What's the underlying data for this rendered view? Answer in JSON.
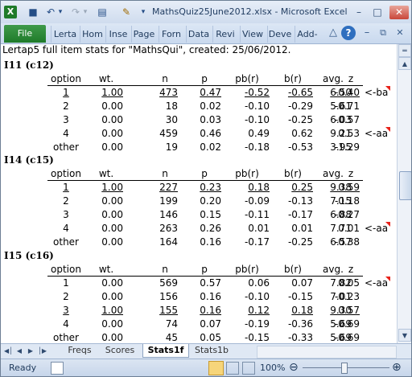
{
  "window": {
    "title": "MathsQuiz25June2012.xlsx - Microsoft Excel",
    "controls": {
      "minimize": "–",
      "maximize": "□",
      "close": "✕"
    }
  },
  "quick_access": {
    "app_icon": "X",
    "save": "■",
    "undo": "↶",
    "undo_drop": "▾",
    "redo": "↷",
    "redo_drop": "▾",
    "form": "▤",
    "brush": "✎",
    "customize": "▾"
  },
  "ribbon": {
    "file_label": "File",
    "tabs": [
      "Lerta",
      "Hom",
      "Inse",
      "Page",
      "Forn",
      "Data",
      "Revi",
      "View",
      "Deve",
      "Add-"
    ],
    "icons": {
      "minimize_ribbon": "△",
      "help": "?",
      "min": "–",
      "restore": "⧉",
      "close": "✕"
    }
  },
  "sheet": {
    "header": "Lertap5 full item stats for \"MathsQui\", created: 25/06/2012.",
    "columns": [
      "option",
      "wt.",
      "n",
      "p",
      "pb(r)",
      "b(r)",
      "avg.",
      "z"
    ],
    "items": [
      {
        "title": "I11 (c12)",
        "rows": [
          {
            "option": "1",
            "wt": "1.00",
            "n": "473",
            "p": "0.47",
            "pbr": "-0.52",
            "br": "-0.65",
            "avg": "6.50",
            "z": "-0.40",
            "note": "<-ba",
            "key": true,
            "mark": true
          },
          {
            "option": "2",
            "wt": "0.00",
            "n": "18",
            "p": "0.02",
            "pbr": "-0.10",
            "br": "-0.29",
            "avg": "5.61",
            "z": "-0.71",
            "note": "",
            "key": false,
            "mark": false
          },
          {
            "option": "3",
            "wt": "0.00",
            "n": "30",
            "p": "0.03",
            "pbr": "-0.10",
            "br": "-0.25",
            "avg": "6.03",
            "z": "-0.57",
            "note": "",
            "key": false,
            "mark": false
          },
          {
            "option": "4",
            "wt": "0.00",
            "n": "459",
            "p": "0.46",
            "pbr": "0.49",
            "br": "0.62",
            "avg": "9.21",
            "z": "0.53",
            "note": "<-aa",
            "key": false,
            "mark": true
          },
          {
            "option": "other",
            "wt": "0.00",
            "n": "19",
            "p": "0.02",
            "pbr": "-0.18",
            "br": "-0.53",
            "avg": "3.95",
            "z": "-1.29",
            "note": "",
            "key": false,
            "mark": false
          }
        ]
      },
      {
        "title": "I14 (c15)",
        "rows": [
          {
            "option": "1",
            "wt": "1.00",
            "n": "227",
            "p": "0.23",
            "pbr": "0.18",
            "br": "0.25",
            "avg": "9.38",
            "z": "0.59",
            "note": "",
            "key": true,
            "mark": false
          },
          {
            "option": "2",
            "wt": "0.00",
            "n": "199",
            "p": "0.20",
            "pbr": "-0.09",
            "br": "-0.13",
            "avg": "7.15",
            "z": "-0.18",
            "note": "",
            "key": false,
            "mark": false
          },
          {
            "option": "3",
            "wt": "0.00",
            "n": "146",
            "p": "0.15",
            "pbr": "-0.11",
            "br": "-0.17",
            "avg": "6.88",
            "z": "-0.27",
            "note": "",
            "key": false,
            "mark": false
          },
          {
            "option": "4",
            "wt": "0.00",
            "n": "263",
            "p": "0.26",
            "pbr": "0.01",
            "br": "0.01",
            "avg": "7.71",
            "z": "0.01",
            "note": "<-aa",
            "key": false,
            "mark": true
          },
          {
            "option": "other",
            "wt": "0.00",
            "n": "164",
            "p": "0.16",
            "pbr": "-0.17",
            "br": "-0.25",
            "avg": "6.57",
            "z": "-0.38",
            "note": "",
            "key": false,
            "mark": false
          }
        ]
      },
      {
        "title": "I15 (c16)",
        "rows": [
          {
            "option": "1",
            "wt": "0.00",
            "n": "569",
            "p": "0.57",
            "pbr": "0.06",
            "br": "0.07",
            "avg": "7.82",
            "z": "0.05",
            "note": "<-aa",
            "key": false,
            "mark": true
          },
          {
            "option": "2",
            "wt": "0.00",
            "n": "156",
            "p": "0.16",
            "pbr": "-0.10",
            "br": "-0.15",
            "avg": "7.01",
            "z": "-0.23",
            "note": "",
            "key": false,
            "mark": false
          },
          {
            "option": "3",
            "wt": "1.00",
            "n": "155",
            "p": "0.16",
            "pbr": "0.12",
            "br": "0.18",
            "avg": "9.30",
            "z": "0.57",
            "note": "",
            "key": true,
            "mark": false
          },
          {
            "option": "4",
            "wt": "0.00",
            "n": "74",
            "p": "0.07",
            "pbr": "-0.19",
            "br": "-0.36",
            "avg": "5.69",
            "z": "-0.69",
            "note": "",
            "key": false,
            "mark": false
          },
          {
            "option": "other",
            "wt": "0.00",
            "n": "45",
            "p": "0.05",
            "pbr": "-0.15",
            "br": "-0.33",
            "avg": "5.69",
            "z": "-0.69",
            "note": "",
            "key": false,
            "mark": false
          }
        ]
      }
    ]
  },
  "scrollbar": {
    "up": "▲",
    "down": "▼",
    "split": "═"
  },
  "sheet_tabs": {
    "nav": [
      "◀│",
      "◀",
      "▶",
      "│▶"
    ],
    "tabs": [
      "Freqs",
      "Scores",
      "Stats1f",
      "Stats1b"
    ],
    "active": "Stats1f"
  },
  "status": {
    "ready": "Ready",
    "zoom": "100%",
    "zoom_out": "⊖",
    "zoom_in": "⊕"
  },
  "colors": {
    "file_tab": "#2a8637",
    "comment_marker": "#e8221a",
    "accent": "#1e395b"
  }
}
